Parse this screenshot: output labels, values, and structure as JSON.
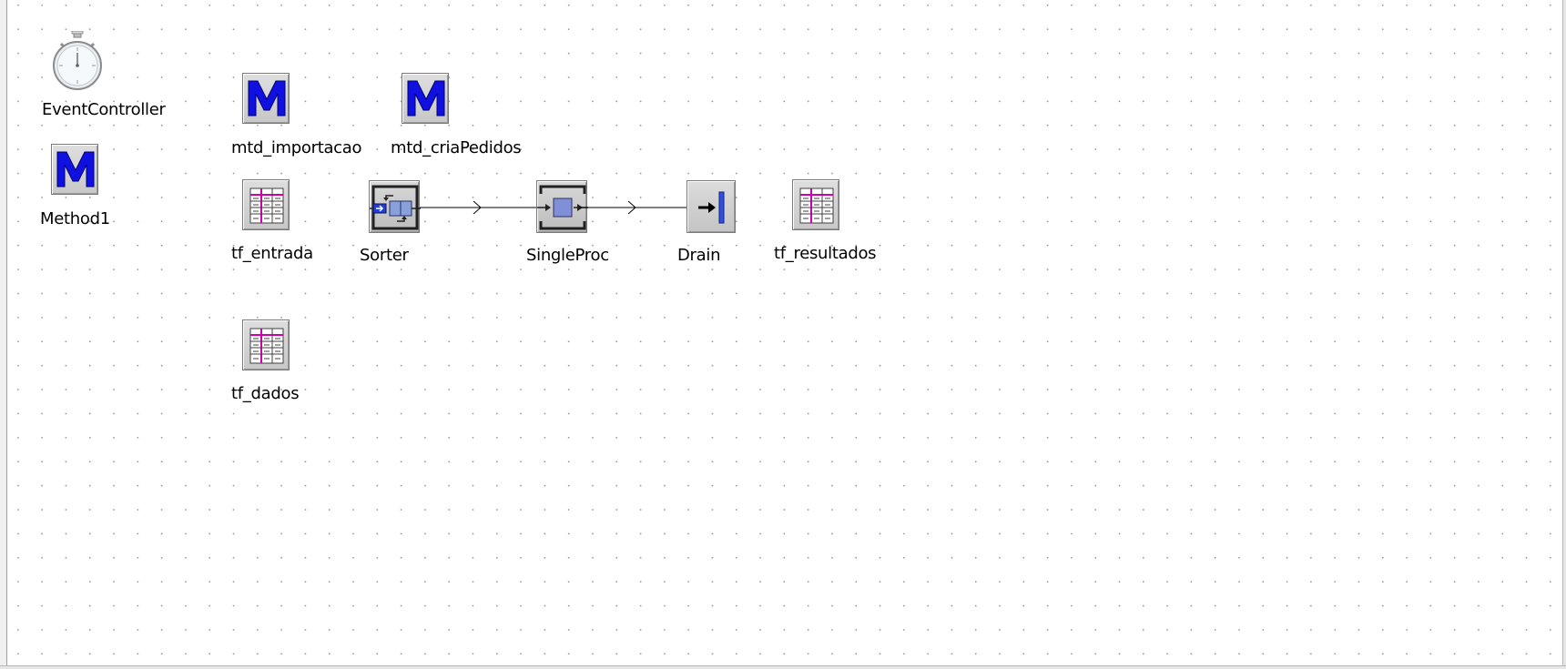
{
  "objects": {
    "event_controller": {
      "label": "EventController"
    },
    "method1": {
      "label": "Method1"
    },
    "mtd_importacao": {
      "label": "mtd_importacao"
    },
    "mtd_criapedidos": {
      "label": "mtd_criaPedidos"
    },
    "tf_entrada": {
      "label": "tf_entrada"
    },
    "sorter": {
      "label": "Sorter"
    },
    "singleproc": {
      "label": "SingleProc"
    },
    "drain": {
      "label": "Drain"
    },
    "tf_resultados": {
      "label": "tf_resultados"
    },
    "tf_dados": {
      "label": "tf_dados"
    }
  },
  "connectors": [
    {
      "from": "Sorter",
      "to": "SingleProc"
    },
    {
      "from": "SingleProc",
      "to": "Drain"
    }
  ],
  "colors": {
    "method_letter": "#1010e0",
    "table_accent": "#d000b0",
    "proc_blue": "#7f8fd8",
    "grid_dot": "#9a9a9a"
  }
}
